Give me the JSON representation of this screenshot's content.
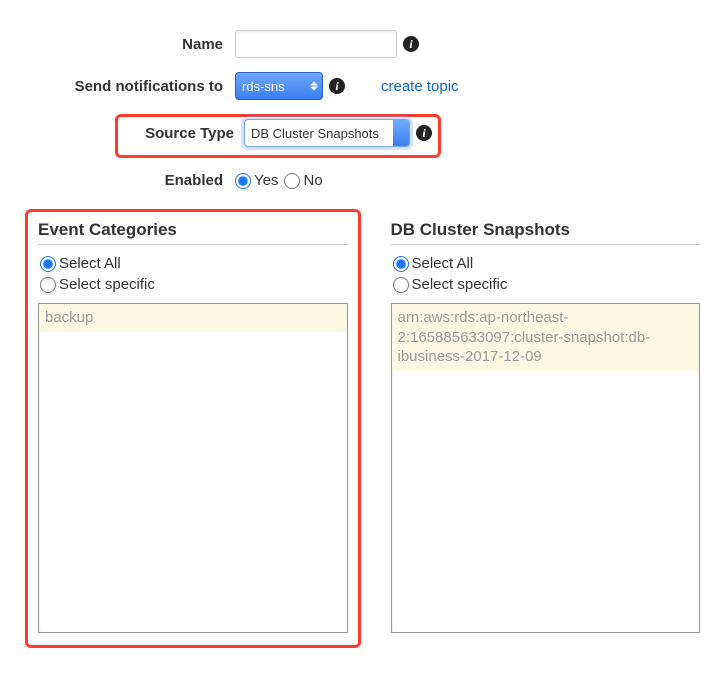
{
  "form": {
    "name_label": "Name",
    "name_value": "",
    "notify_label": "Send notifications to",
    "notify_value": "rds-sns",
    "create_topic": "create topic",
    "source_type_label": "Source Type",
    "source_type_value": "DB Cluster Snapshots",
    "enabled_label": "Enabled",
    "enabled_yes": "Yes",
    "enabled_no": "No",
    "enabled_value": "Yes"
  },
  "event_categories": {
    "heading": "Event Categories",
    "select_all": "Select All",
    "select_specific": "Select specific",
    "selection": "all",
    "items": [
      "backup"
    ]
  },
  "db_snapshots": {
    "heading": "DB Cluster Snapshots",
    "select_all": "Select All",
    "select_specific": "Select specific",
    "selection": "all",
    "items": [
      "arn:aws:rds:ap-northeast-2:165885633097:cluster-snapshot:db-ibusiness-2017-12-09"
    ]
  },
  "icons": {
    "info": "i"
  }
}
